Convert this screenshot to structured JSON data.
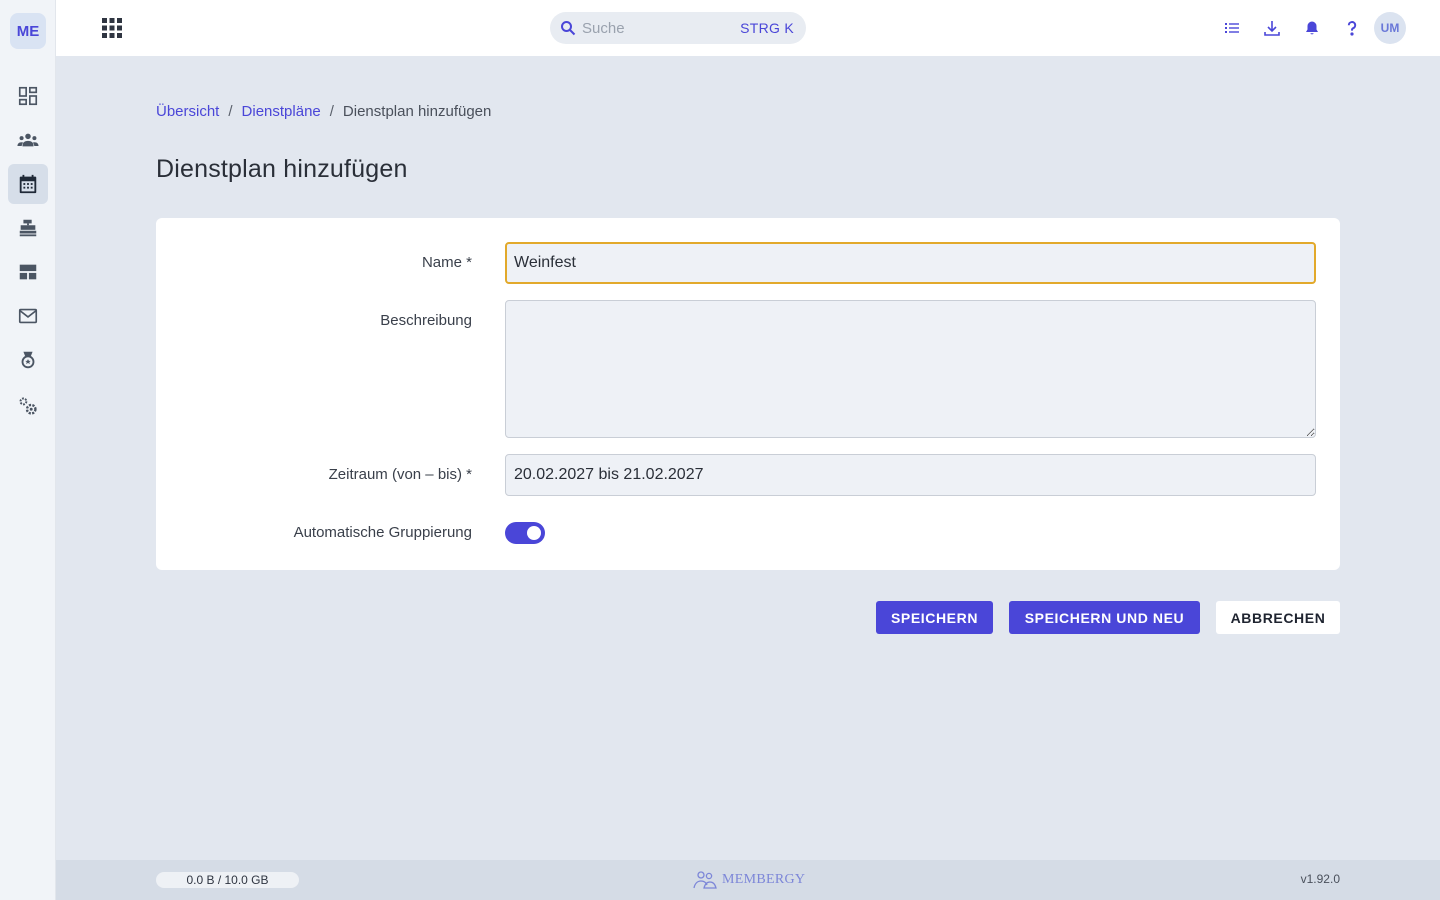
{
  "app": {
    "logo_text": "ME",
    "brand_name": "MEMBERGY",
    "accent_color": "#4a46d8",
    "focus_color": "#e2a92b"
  },
  "sidebar": {
    "items": [
      {
        "icon": "dashboard-icon",
        "active": false
      },
      {
        "icon": "members-icon",
        "active": false
      },
      {
        "icon": "calendar-icon",
        "active": true
      },
      {
        "icon": "cash-register-icon",
        "active": false
      },
      {
        "icon": "layout-icon",
        "active": false
      },
      {
        "icon": "mail-icon",
        "active": false
      },
      {
        "icon": "award-icon",
        "active": false
      },
      {
        "icon": "settings-icon",
        "active": false
      }
    ]
  },
  "topbar": {
    "search_placeholder": "Suche",
    "search_shortcut": "STRG K",
    "icons": [
      "task-list-icon",
      "download-icon",
      "bell-icon",
      "help-icon"
    ],
    "avatar_initials": "UM"
  },
  "breadcrumb": {
    "items": [
      "Übersicht",
      "Dienstpläne"
    ],
    "separator": "/",
    "current": "Dienstplan hinzufügen"
  },
  "page": {
    "title": "Dienstplan hinzufügen"
  },
  "form": {
    "name_label": "Name *",
    "name_value": "Weinfest",
    "description_label": "Beschreibung",
    "description_value": "",
    "period_label": "Zeitraum (von – bis) *",
    "period_value": "20.02.2027 bis 21.02.2027",
    "grouping_label": "Automatische Gruppierung",
    "grouping_enabled": true
  },
  "actions": {
    "save_label": "SPEICHERN",
    "save_new_label": "SPEICHERN UND NEU",
    "cancel_label": "ABBRECHEN"
  },
  "footer": {
    "storage_text": "0.0 B / 10.0 GB",
    "version": "v1.92.0"
  }
}
